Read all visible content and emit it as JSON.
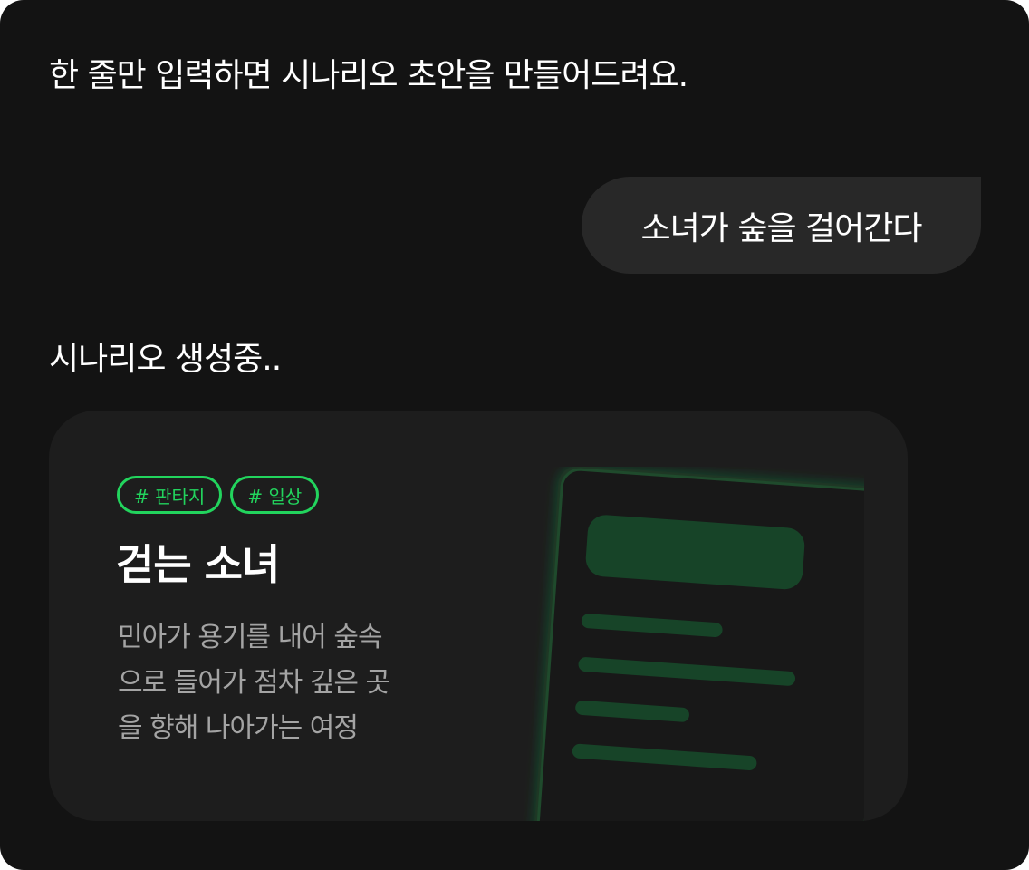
{
  "intro_message": "한 줄만 입력하면 시나리오 초안을 만들어드려요.",
  "user_message": "소녀가 숲을 걸어간다",
  "status_text": "시나리오 생성중..",
  "scenario_card": {
    "tags": [
      "# 판타지",
      "# 일상"
    ],
    "title": "걷는 소녀",
    "description_lines": [
      "민아가 용기를 내어 숲속",
      "으로 들어가 점차 깊은 곳",
      "을 향해 나아가는 여정"
    ],
    "illustration_icon": "document-icon"
  },
  "colors": {
    "background": "#131313",
    "bubble": "#282828",
    "card": "#1d1d1d",
    "accent": "#22d45d",
    "doc_line": "#174428",
    "muted_text": "#a4a4a4"
  }
}
